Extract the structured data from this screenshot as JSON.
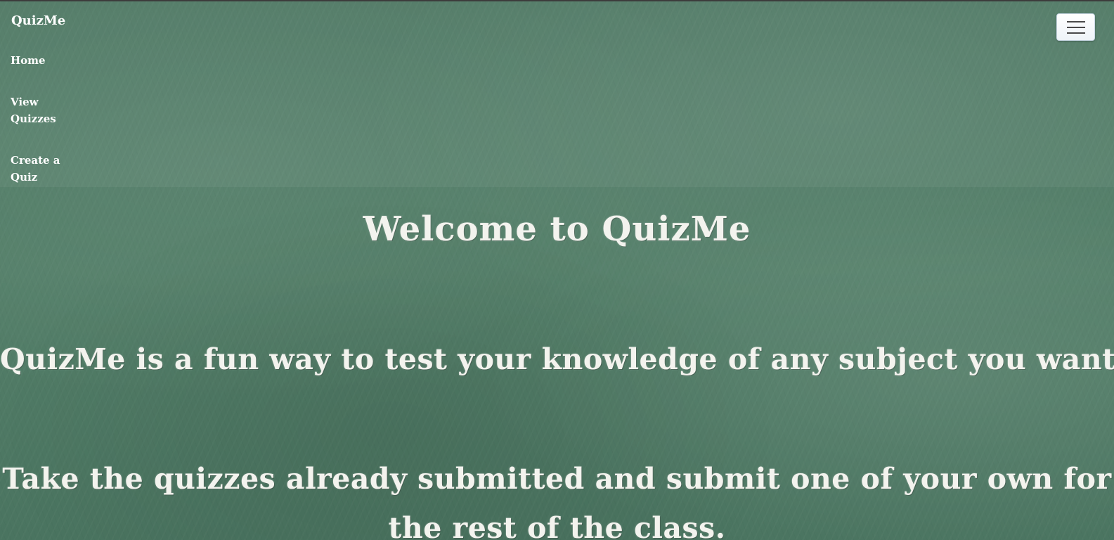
{
  "nav": {
    "brand": "QuizMe",
    "links": [
      {
        "label": "Home"
      },
      {
        "label": "View Quizzes"
      },
      {
        "label": "Create a Quiz"
      }
    ],
    "toggler_icon": "hamburger-menu-icon"
  },
  "main": {
    "title": "Welcome to QuizMe",
    "intro": "QuizMe is a fun way to test your knowledge of any subject you want.",
    "cta": "Take the quizzes already submitted and submit one of your own for the rest of the class."
  },
  "colors": {
    "chalkboard": "#4f7a64",
    "chalk": "#f3f3ee",
    "toggler_background": "#ffffff"
  }
}
